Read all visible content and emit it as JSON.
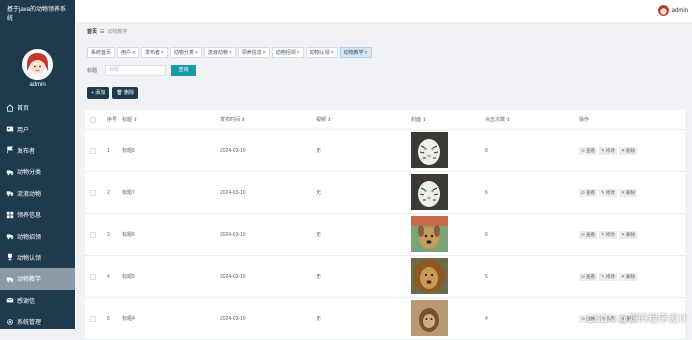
{
  "app": {
    "title": "基于java的动物领养系统"
  },
  "sidebar": {
    "admin_name": "admin",
    "items": [
      {
        "label": "首页",
        "icon": "home-icon"
      },
      {
        "label": "用户",
        "icon": "user-icon"
      },
      {
        "label": "发布者",
        "icon": "flag-icon"
      },
      {
        "label": "动物分类",
        "icon": "truck-icon"
      },
      {
        "label": "流浪动物",
        "icon": "truck-icon"
      },
      {
        "label": "领养信息",
        "icon": "grid-icon"
      },
      {
        "label": "动物招领",
        "icon": "truck-icon"
      },
      {
        "label": "动物认领",
        "icon": "trophy-icon"
      },
      {
        "label": "动物教学",
        "icon": "truck-icon",
        "active": true
      },
      {
        "label": "感谢信",
        "icon": "mail-icon"
      },
      {
        "label": "系统管理",
        "icon": "gear-icon"
      }
    ]
  },
  "topbar": {
    "user": "admin"
  },
  "breadcrumb": {
    "home": "首页",
    "sep": "☰",
    "current": "动物教学"
  },
  "tabs": [
    {
      "label": "系统首页",
      "closable": false
    },
    {
      "label": "用户",
      "closable": true
    },
    {
      "label": "发布者",
      "closable": true
    },
    {
      "label": "动物分类",
      "closable": true
    },
    {
      "label": "流浪动物",
      "closable": true
    },
    {
      "label": "领养信息",
      "closable": true
    },
    {
      "label": "动物招领",
      "closable": true
    },
    {
      "label": "动物认领",
      "closable": true
    },
    {
      "label": "动物教学",
      "closable": true,
      "active": true
    }
  ],
  "search": {
    "label": "标题",
    "placeholder": "标题",
    "button": "查询"
  },
  "actions": {
    "add": "+ 添加",
    "delete": "🗑 删除"
  },
  "table": {
    "columns": [
      "",
      "序号",
      "标题 ⇕",
      "发布时间 ⇕",
      "视频 ⇕",
      "封面 ⇕",
      "点击次数 ⇕",
      "操作"
    ],
    "ops": {
      "view": "⊙ 查看",
      "edit": "✎ 修改",
      "delete": "✕ 删除"
    },
    "rows": [
      {
        "idx": "1",
        "title": "标题8",
        "date": "2024-03-10",
        "video": "无",
        "clicks": "8",
        "cover": "white-tiger"
      },
      {
        "idx": "2",
        "title": "标题7",
        "date": "2024-03-10",
        "video": "无",
        "clicks": "6",
        "cover": "white-tiger"
      },
      {
        "idx": "3",
        "title": "标题6",
        "date": "2024-03-10",
        "video": "无",
        "clicks": "6",
        "cover": "dog"
      },
      {
        "idx": "4",
        "title": "标题5",
        "date": "2024-03-10",
        "video": "无",
        "clicks": "5",
        "cover": "lion"
      },
      {
        "idx": "5",
        "title": "标题4",
        "date": "2024-03-10",
        "video": "无",
        "clicks": "4",
        "cover": "monkey"
      }
    ]
  },
  "watermark": "CSDN @源码程序设计",
  "colors": {
    "sidebar": "#1f3a4d",
    "accent": "#1a9aa8",
    "active_menu": "#8a9aa8"
  }
}
